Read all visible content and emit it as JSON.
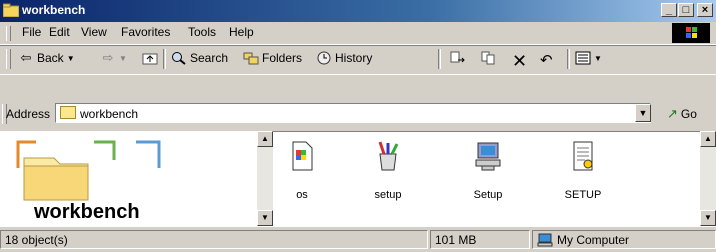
{
  "window": {
    "title": "workbench",
    "minimize": "_",
    "maximize": "□",
    "close": "×"
  },
  "menu": [
    "File",
    "Edit",
    "View",
    "Favorites",
    "Tools",
    "Help"
  ],
  "toolbar": {
    "back": "Back",
    "search": "Search",
    "folders": "Folders",
    "history": "History"
  },
  "address": {
    "label": "Address",
    "value": "workbench",
    "go": "Go"
  },
  "left_pane": {
    "folder_title": "workbench"
  },
  "files": [
    {
      "name": "os",
      "icon": "media-file-icon"
    },
    {
      "name": "setup",
      "icon": "setup-tools-icon"
    },
    {
      "name": "Setup",
      "icon": "setup-computer-icon"
    },
    {
      "name": "SETUP",
      "icon": "settings-document-icon"
    }
  ],
  "status": {
    "objects": "18 object(s)",
    "size": "101 MB",
    "zone": "My Computer"
  }
}
